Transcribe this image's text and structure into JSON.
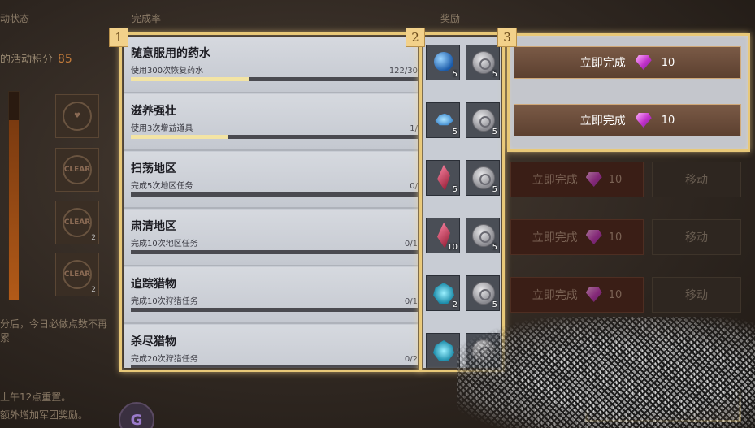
{
  "left_panel": {
    "status_label": "动状态",
    "points_label": "的活动积分",
    "points_value": "85",
    "badges": [
      {
        "icon": "shield-badge-icon",
        "text": "",
        "count": ""
      },
      {
        "icon": "clear-badge-icon",
        "text": "CLEAR",
        "count": ""
      },
      {
        "icon": "clear-badge-icon",
        "text": "CLEAR",
        "count": "2"
      },
      {
        "icon": "clear-badge-icon",
        "text": "CLEAR",
        "count": "2"
      }
    ],
    "note_reset_1": "分后，今日必做点数不再累",
    "note_reset_2": "上午12点重置。",
    "note_reset_3": "额外增加军团奖励。",
    "avatar_letter": "G"
  },
  "headers": {
    "completion": "完成率",
    "reward": "奖励"
  },
  "markers": [
    "1",
    "2",
    "3"
  ],
  "tasks": [
    {
      "title": "随意服用的药水",
      "desc": "使用300次恢复药水",
      "progress": "122/30",
      "fill": 0.41
    },
    {
      "title": "滋养强壮",
      "desc": "使用3次增益道具",
      "progress": "1/",
      "fill": 0.34
    },
    {
      "title": "扫荡地区",
      "desc": "完成5次地区任务",
      "progress": "0/",
      "fill": 0
    },
    {
      "title": "肃清地区",
      "desc": "完成10次地区任务",
      "progress": "0/1",
      "fill": 0
    },
    {
      "title": "追踪猎物",
      "desc": "完成10次狩猎任务",
      "progress": "0/1",
      "fill": 0
    },
    {
      "title": "杀尽猎物",
      "desc": "完成20次狩猎任务",
      "progress": "0/2",
      "fill": 0
    }
  ],
  "rewards": [
    {
      "item1": {
        "icon": "blue-orb-icon",
        "qty": "5"
      },
      "item2": {
        "icon": "silver-coin-icon",
        "qty": "5"
      }
    },
    {
      "item1": {
        "icon": "blue-crystal-icon",
        "qty": "5"
      },
      "item2": {
        "icon": "silver-coin-icon",
        "qty": "5"
      }
    },
    {
      "item1": {
        "icon": "red-shard-icon",
        "qty": "5"
      },
      "item2": {
        "icon": "silver-coin-icon",
        "qty": "5"
      }
    },
    {
      "item1": {
        "icon": "red-shard-icon",
        "qty": "10"
      },
      "item2": {
        "icon": "silver-coin-icon",
        "qty": "5"
      }
    },
    {
      "item1": {
        "icon": "cyan-gem-icon",
        "qty": "2"
      },
      "item2": {
        "icon": "silver-coin-icon",
        "qty": "5"
      }
    },
    {
      "item1": {
        "icon": "cyan-gem-icon",
        "qty": ""
      },
      "item2": {
        "icon": "silver-coin-icon",
        "qty": ""
      }
    }
  ],
  "actions": [
    {
      "complete_label": "立即完成",
      "cost": "10"
    },
    {
      "complete_label": "立即完成",
      "cost": "10"
    },
    {
      "complete_label": "立即完成",
      "cost": "10",
      "move_label": "移动"
    },
    {
      "complete_label": "立即完成",
      "cost": "10",
      "move_label": "移动"
    },
    {
      "complete_label": "立即完成",
      "cost": "10",
      "move_label": "移动"
    }
  ],
  "colors": {
    "highlight_border": "#e8c878",
    "marker_bg": "#f2d18a",
    "points_accent": "#c07a3a",
    "progress_fill": "#f3e4a4"
  }
}
